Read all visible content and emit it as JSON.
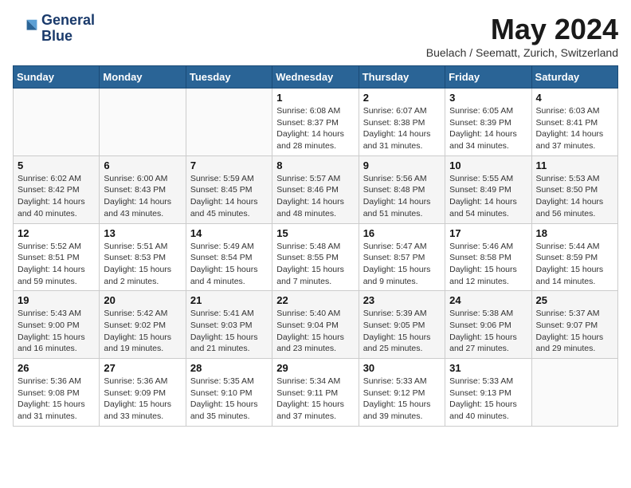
{
  "header": {
    "logo_line1": "General",
    "logo_line2": "Blue",
    "title": "May 2024",
    "subtitle": "Buelach / Seematt, Zurich, Switzerland"
  },
  "days_of_week": [
    "Sunday",
    "Monday",
    "Tuesday",
    "Wednesday",
    "Thursday",
    "Friday",
    "Saturday"
  ],
  "weeks": [
    [
      {
        "num": "",
        "info": ""
      },
      {
        "num": "",
        "info": ""
      },
      {
        "num": "",
        "info": ""
      },
      {
        "num": "1",
        "info": "Sunrise: 6:08 AM\nSunset: 8:37 PM\nDaylight: 14 hours\nand 28 minutes."
      },
      {
        "num": "2",
        "info": "Sunrise: 6:07 AM\nSunset: 8:38 PM\nDaylight: 14 hours\nand 31 minutes."
      },
      {
        "num": "3",
        "info": "Sunrise: 6:05 AM\nSunset: 8:39 PM\nDaylight: 14 hours\nand 34 minutes."
      },
      {
        "num": "4",
        "info": "Sunrise: 6:03 AM\nSunset: 8:41 PM\nDaylight: 14 hours\nand 37 minutes."
      }
    ],
    [
      {
        "num": "5",
        "info": "Sunrise: 6:02 AM\nSunset: 8:42 PM\nDaylight: 14 hours\nand 40 minutes."
      },
      {
        "num": "6",
        "info": "Sunrise: 6:00 AM\nSunset: 8:43 PM\nDaylight: 14 hours\nand 43 minutes."
      },
      {
        "num": "7",
        "info": "Sunrise: 5:59 AM\nSunset: 8:45 PM\nDaylight: 14 hours\nand 45 minutes."
      },
      {
        "num": "8",
        "info": "Sunrise: 5:57 AM\nSunset: 8:46 PM\nDaylight: 14 hours\nand 48 minutes."
      },
      {
        "num": "9",
        "info": "Sunrise: 5:56 AM\nSunset: 8:48 PM\nDaylight: 14 hours\nand 51 minutes."
      },
      {
        "num": "10",
        "info": "Sunrise: 5:55 AM\nSunset: 8:49 PM\nDaylight: 14 hours\nand 54 minutes."
      },
      {
        "num": "11",
        "info": "Sunrise: 5:53 AM\nSunset: 8:50 PM\nDaylight: 14 hours\nand 56 minutes."
      }
    ],
    [
      {
        "num": "12",
        "info": "Sunrise: 5:52 AM\nSunset: 8:51 PM\nDaylight: 14 hours\nand 59 minutes."
      },
      {
        "num": "13",
        "info": "Sunrise: 5:51 AM\nSunset: 8:53 PM\nDaylight: 15 hours\nand 2 minutes."
      },
      {
        "num": "14",
        "info": "Sunrise: 5:49 AM\nSunset: 8:54 PM\nDaylight: 15 hours\nand 4 minutes."
      },
      {
        "num": "15",
        "info": "Sunrise: 5:48 AM\nSunset: 8:55 PM\nDaylight: 15 hours\nand 7 minutes."
      },
      {
        "num": "16",
        "info": "Sunrise: 5:47 AM\nSunset: 8:57 PM\nDaylight: 15 hours\nand 9 minutes."
      },
      {
        "num": "17",
        "info": "Sunrise: 5:46 AM\nSunset: 8:58 PM\nDaylight: 15 hours\nand 12 minutes."
      },
      {
        "num": "18",
        "info": "Sunrise: 5:44 AM\nSunset: 8:59 PM\nDaylight: 15 hours\nand 14 minutes."
      }
    ],
    [
      {
        "num": "19",
        "info": "Sunrise: 5:43 AM\nSunset: 9:00 PM\nDaylight: 15 hours\nand 16 minutes."
      },
      {
        "num": "20",
        "info": "Sunrise: 5:42 AM\nSunset: 9:02 PM\nDaylight: 15 hours\nand 19 minutes."
      },
      {
        "num": "21",
        "info": "Sunrise: 5:41 AM\nSunset: 9:03 PM\nDaylight: 15 hours\nand 21 minutes."
      },
      {
        "num": "22",
        "info": "Sunrise: 5:40 AM\nSunset: 9:04 PM\nDaylight: 15 hours\nand 23 minutes."
      },
      {
        "num": "23",
        "info": "Sunrise: 5:39 AM\nSunset: 9:05 PM\nDaylight: 15 hours\nand 25 minutes."
      },
      {
        "num": "24",
        "info": "Sunrise: 5:38 AM\nSunset: 9:06 PM\nDaylight: 15 hours\nand 27 minutes."
      },
      {
        "num": "25",
        "info": "Sunrise: 5:37 AM\nSunset: 9:07 PM\nDaylight: 15 hours\nand 29 minutes."
      }
    ],
    [
      {
        "num": "26",
        "info": "Sunrise: 5:36 AM\nSunset: 9:08 PM\nDaylight: 15 hours\nand 31 minutes."
      },
      {
        "num": "27",
        "info": "Sunrise: 5:36 AM\nSunset: 9:09 PM\nDaylight: 15 hours\nand 33 minutes."
      },
      {
        "num": "28",
        "info": "Sunrise: 5:35 AM\nSunset: 9:10 PM\nDaylight: 15 hours\nand 35 minutes."
      },
      {
        "num": "29",
        "info": "Sunrise: 5:34 AM\nSunset: 9:11 PM\nDaylight: 15 hours\nand 37 minutes."
      },
      {
        "num": "30",
        "info": "Sunrise: 5:33 AM\nSunset: 9:12 PM\nDaylight: 15 hours\nand 39 minutes."
      },
      {
        "num": "31",
        "info": "Sunrise: 5:33 AM\nSunset: 9:13 PM\nDaylight: 15 hours\nand 40 minutes."
      },
      {
        "num": "",
        "info": ""
      }
    ]
  ]
}
